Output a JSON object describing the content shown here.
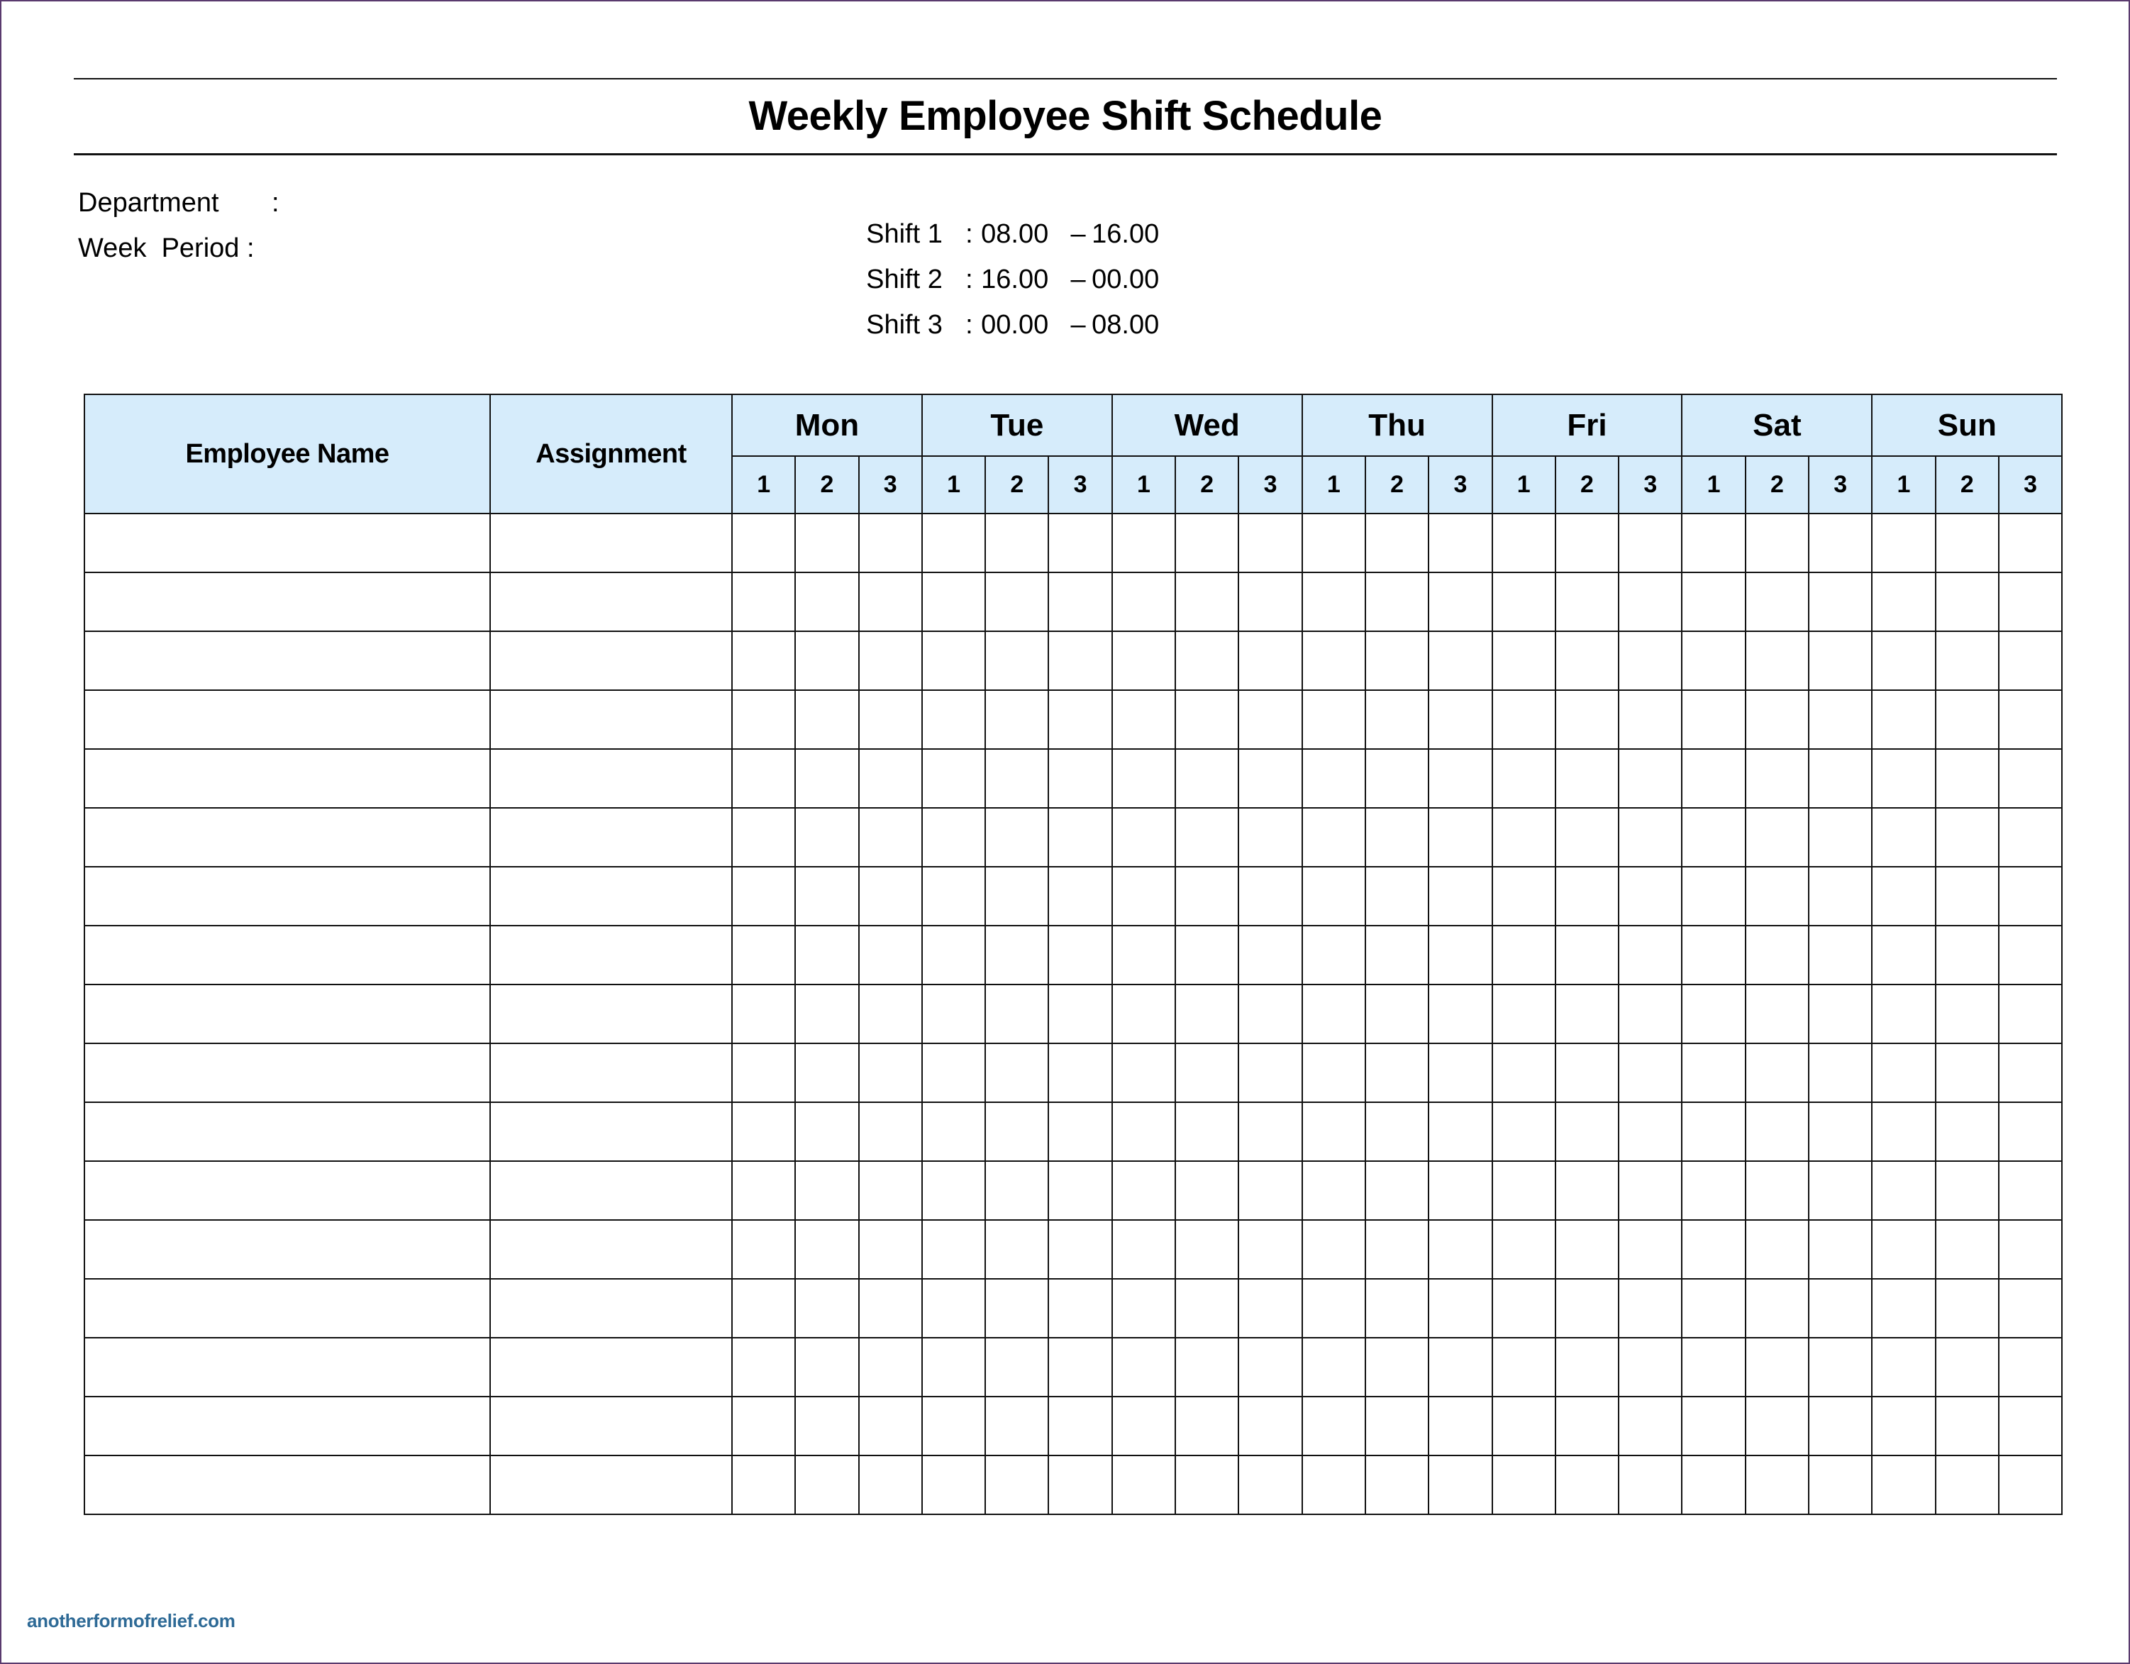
{
  "document": {
    "title": "Weekly Employee Shift Schedule",
    "department_label": "Department",
    "department_colon": ":",
    "department_value": "",
    "week_period_label": "Week  Period :",
    "week_period_value": ""
  },
  "shifts": [
    {
      "name": "Shift 1",
      "colon": ":",
      "start": "08.00",
      "dash": "–",
      "end": "16.00"
    },
    {
      "name": "Shift 2",
      "colon": ":",
      "start": "16.00",
      "dash": "–",
      "end": "00.00"
    },
    {
      "name": "Shift 3",
      "colon": ":",
      "start": "00.00",
      "dash": "–",
      "end": "08.00"
    }
  ],
  "table": {
    "headers": {
      "employee_name": "Employee Name",
      "assignment": "Assignment"
    },
    "days": [
      "Mon",
      "Tue",
      "Wed",
      "Thu",
      "Fri",
      "Sat",
      "Sun"
    ],
    "shift_numbers": [
      "1",
      "2",
      "3"
    ],
    "row_count": 17,
    "rows": [
      {
        "employee": "",
        "assignment": "",
        "shifts": [
          "",
          "",
          "",
          "",
          "",
          "",
          "",
          "",
          "",
          "",
          "",
          "",
          "",
          "",
          "",
          "",
          "",
          "",
          "",
          "",
          ""
        ]
      },
      {
        "employee": "",
        "assignment": "",
        "shifts": [
          "",
          "",
          "",
          "",
          "",
          "",
          "",
          "",
          "",
          "",
          "",
          "",
          "",
          "",
          "",
          "",
          "",
          "",
          "",
          "",
          ""
        ]
      },
      {
        "employee": "",
        "assignment": "",
        "shifts": [
          "",
          "",
          "",
          "",
          "",
          "",
          "",
          "",
          "",
          "",
          "",
          "",
          "",
          "",
          "",
          "",
          "",
          "",
          "",
          "",
          ""
        ]
      },
      {
        "employee": "",
        "assignment": "",
        "shifts": [
          "",
          "",
          "",
          "",
          "",
          "",
          "",
          "",
          "",
          "",
          "",
          "",
          "",
          "",
          "",
          "",
          "",
          "",
          "",
          "",
          ""
        ]
      },
      {
        "employee": "",
        "assignment": "",
        "shifts": [
          "",
          "",
          "",
          "",
          "",
          "",
          "",
          "",
          "",
          "",
          "",
          "",
          "",
          "",
          "",
          "",
          "",
          "",
          "",
          "",
          ""
        ]
      },
      {
        "employee": "",
        "assignment": "",
        "shifts": [
          "",
          "",
          "",
          "",
          "",
          "",
          "",
          "",
          "",
          "",
          "",
          "",
          "",
          "",
          "",
          "",
          "",
          "",
          "",
          "",
          ""
        ]
      },
      {
        "employee": "",
        "assignment": "",
        "shifts": [
          "",
          "",
          "",
          "",
          "",
          "",
          "",
          "",
          "",
          "",
          "",
          "",
          "",
          "",
          "",
          "",
          "",
          "",
          "",
          "",
          ""
        ]
      },
      {
        "employee": "",
        "assignment": "",
        "shifts": [
          "",
          "",
          "",
          "",
          "",
          "",
          "",
          "",
          "",
          "",
          "",
          "",
          "",
          "",
          "",
          "",
          "",
          "",
          "",
          "",
          ""
        ]
      },
      {
        "employee": "",
        "assignment": "",
        "shifts": [
          "",
          "",
          "",
          "",
          "",
          "",
          "",
          "",
          "",
          "",
          "",
          "",
          "",
          "",
          "",
          "",
          "",
          "",
          "",
          "",
          ""
        ]
      },
      {
        "employee": "",
        "assignment": "",
        "shifts": [
          "",
          "",
          "",
          "",
          "",
          "",
          "",
          "",
          "",
          "",
          "",
          "",
          "",
          "",
          "",
          "",
          "",
          "",
          "",
          "",
          ""
        ]
      },
      {
        "employee": "",
        "assignment": "",
        "shifts": [
          "",
          "",
          "",
          "",
          "",
          "",
          "",
          "",
          "",
          "",
          "",
          "",
          "",
          "",
          "",
          "",
          "",
          "",
          "",
          "",
          ""
        ]
      },
      {
        "employee": "",
        "assignment": "",
        "shifts": [
          "",
          "",
          "",
          "",
          "",
          "",
          "",
          "",
          "",
          "",
          "",
          "",
          "",
          "",
          "",
          "",
          "",
          "",
          "",
          "",
          ""
        ]
      },
      {
        "employee": "",
        "assignment": "",
        "shifts": [
          "",
          "",
          "",
          "",
          "",
          "",
          "",
          "",
          "",
          "",
          "",
          "",
          "",
          "",
          "",
          "",
          "",
          "",
          "",
          "",
          ""
        ]
      },
      {
        "employee": "",
        "assignment": "",
        "shifts": [
          "",
          "",
          "",
          "",
          "",
          "",
          "",
          "",
          "",
          "",
          "",
          "",
          "",
          "",
          "",
          "",
          "",
          "",
          "",
          "",
          ""
        ]
      },
      {
        "employee": "",
        "assignment": "",
        "shifts": [
          "",
          "",
          "",
          "",
          "",
          "",
          "",
          "",
          "",
          "",
          "",
          "",
          "",
          "",
          "",
          "",
          "",
          "",
          "",
          "",
          ""
        ]
      },
      {
        "employee": "",
        "assignment": "",
        "shifts": [
          "",
          "",
          "",
          "",
          "",
          "",
          "",
          "",
          "",
          "",
          "",
          "",
          "",
          "",
          "",
          "",
          "",
          "",
          "",
          "",
          ""
        ]
      },
      {
        "employee": "",
        "assignment": "",
        "shifts": [
          "",
          "",
          "",
          "",
          "",
          "",
          "",
          "",
          "",
          "",
          "",
          "",
          "",
          "",
          "",
          "",
          "",
          "",
          "",
          "",
          ""
        ]
      }
    ]
  },
  "colors": {
    "header_fill": "#d6ecfb",
    "border": "#111111",
    "watermark": "#2e6a96",
    "page_frame": "#5a3a6e"
  },
  "watermark": "anotherformofrelief.com"
}
